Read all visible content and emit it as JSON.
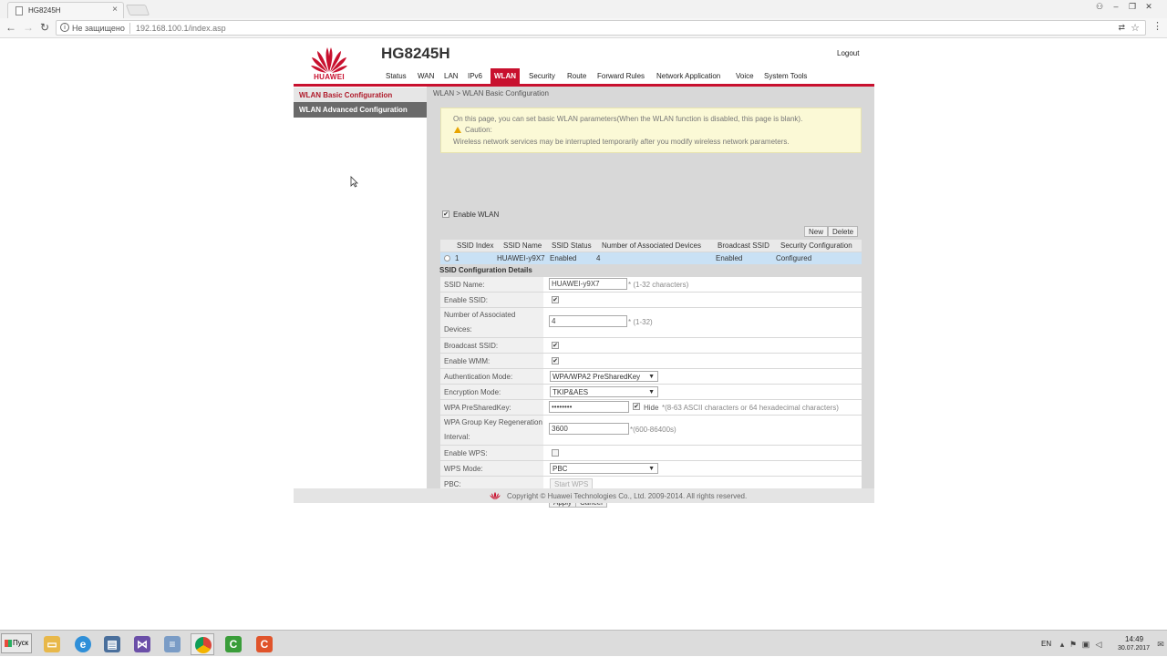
{
  "browser": {
    "tab_title": "HG8245H",
    "security_label": "Не защищено",
    "url": "192.168.100.1/index.asp"
  },
  "router": {
    "brand": "HUAWEI",
    "model": "HG8245H",
    "logout": "Logout",
    "nav": [
      "Status",
      "WAN",
      "LAN",
      "IPv6",
      "WLAN",
      "Security",
      "Route",
      "Forward Rules",
      "Network Application",
      "Voice",
      "System Tools"
    ],
    "active_nav": "WLAN",
    "sidebar": [
      "WLAN Basic Configuration",
      "WLAN Advanced Configuration"
    ],
    "breadcrumb": "WLAN > WLAN Basic Configuration",
    "info": {
      "line1": "On this page, you can set basic WLAN parameters(When the WLAN function is disabled, this page is blank).",
      "caution": "Caution:",
      "line3": "Wireless network services may be interrupted temporarily after you modify wireless network parameters."
    },
    "enable_wlan": "Enable WLAN",
    "new_btn": "New",
    "delete_btn": "Delete",
    "ssid_table": {
      "headers": [
        "SSID Index",
        "SSID Name",
        "SSID Status",
        "Number of Associated Devices",
        "Broadcast SSID",
        "Security Configuration"
      ],
      "rows": [
        [
          "1",
          "HUAWEI-y9X7",
          "Enabled",
          "4",
          "Enabled",
          "Configured"
        ]
      ]
    },
    "details_title": "SSID Configuration Details",
    "form": {
      "ssid_name_label": "SSID Name:",
      "ssid_name_value": "HUAWEI-y9X7",
      "ssid_name_hint": "* (1-32 characters)",
      "enable_ssid_label": "Enable SSID:",
      "assoc_label_1": "Number of Associated",
      "assoc_label_2": "Devices:",
      "assoc_value": "4",
      "assoc_hint": "* (1-32)",
      "broadcast_label": "Broadcast SSID:",
      "wmm_label": "Enable WMM:",
      "auth_label": "Authentication Mode:",
      "auth_value": "WPA/WPA2 PreSharedKey",
      "enc_label": "Encryption Mode:",
      "enc_value": "TKIP&AES",
      "psk_label": "WPA PreSharedKey:",
      "psk_value": "••••••••",
      "psk_hide": "Hide",
      "psk_hint": "*(8-63 ASCII characters or 64 hexadecimal characters)",
      "regen_label_1": "WPA Group Key Regeneration",
      "regen_label_2": "Interval:",
      "regen_value": "3600",
      "regen_hint": "*(600-86400s)",
      "wps_label": "Enable WPS:",
      "wps_mode_label": "WPS Mode:",
      "wps_mode_value": "PBC",
      "pbc_label": "PBC:",
      "start_wps": "Start WPS",
      "apply": "Apply",
      "cancel": "Cancel"
    },
    "footer": "Copyright © Huawei Technologies Co., Ltd. 2009-2014. All rights reserved."
  },
  "taskbar": {
    "start": "Пуск",
    "lang": "EN",
    "time": "14:49",
    "date": "30.07.2017"
  },
  "colors": {
    "huawei_red": "#c8102e",
    "selected_row": "#c9e1f5",
    "info_bg": "#fbf9d6"
  }
}
